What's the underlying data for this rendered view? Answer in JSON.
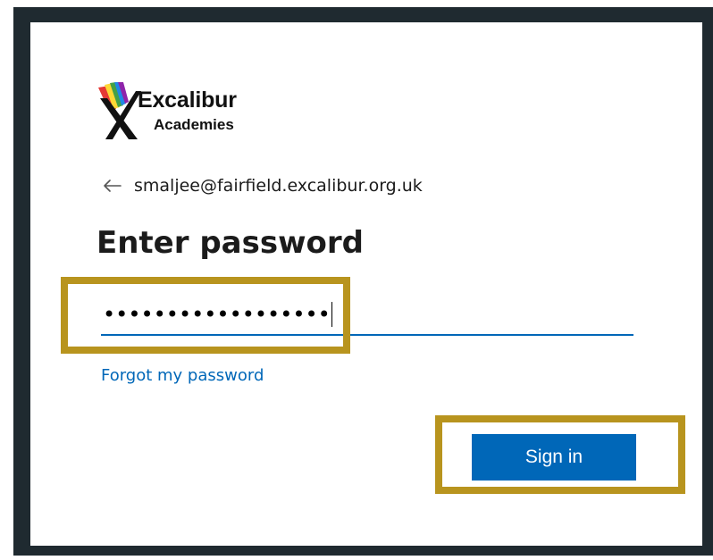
{
  "brand": {
    "name": "Excalibur",
    "subtitle": "Academies",
    "logo_icon": "excalibur-logo-mark"
  },
  "identity": {
    "back_icon": "arrow-left-icon",
    "email": "smaljee@fairfield.excalibur.org.uk"
  },
  "title": "Enter password",
  "password_field": {
    "masked_value": "••••••••••••••••••",
    "type": "password"
  },
  "forgot_link": "Forgot my password",
  "signin_button": "Sign in",
  "colors": {
    "accent": "#0067b8",
    "highlight": "#b8941e",
    "frame": "#1f2a30"
  }
}
